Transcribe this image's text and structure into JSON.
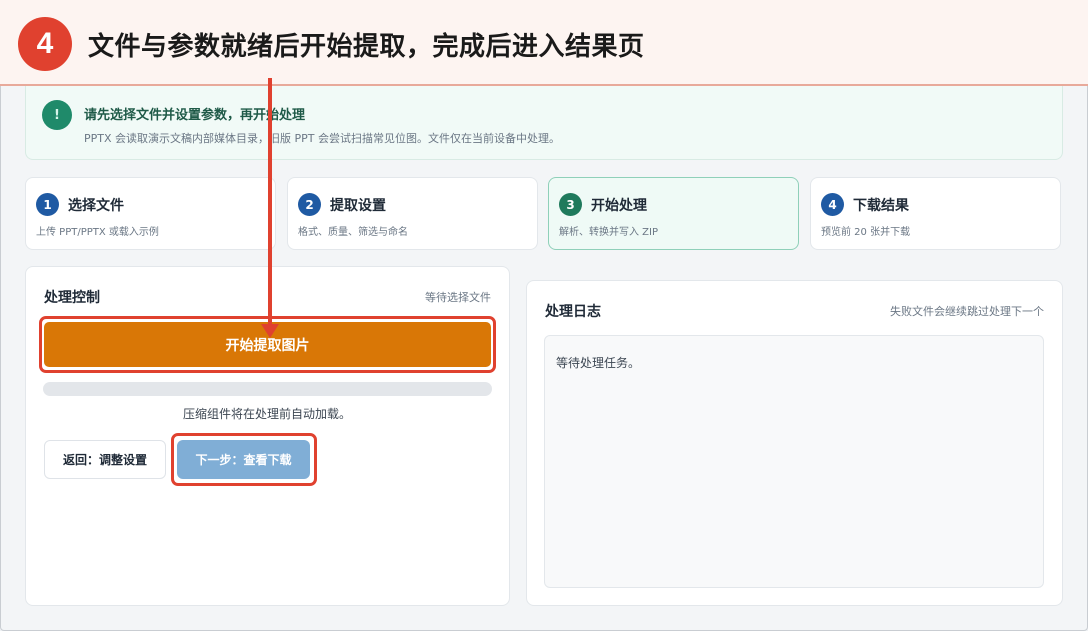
{
  "banner": {
    "step_number": "4",
    "title": "文件与参数就绪后开始提取，完成后进入结果页"
  },
  "notice": {
    "icon": "info-icon",
    "icon_glyph": "!",
    "title": "请先选择文件并设置参数，再开始处理",
    "subtitle": "PPTX 会读取演示文稿内部媒体目录，旧版 PPT 会尝试扫描常见位图。文件仅在当前设备中处理。"
  },
  "steps": [
    {
      "num": "1",
      "title": "选择文件",
      "desc": "上传 PPT/PPTX 或载入示例",
      "active": false
    },
    {
      "num": "2",
      "title": "提取设置",
      "desc": "格式、质量、筛选与命名",
      "active": false
    },
    {
      "num": "3",
      "title": "开始处理",
      "desc": "解析、转换并写入 ZIP",
      "active": true
    },
    {
      "num": "4",
      "title": "下载结果",
      "desc": "预览前 20 张并下载",
      "active": false
    }
  ],
  "control_panel": {
    "title": "处理控制",
    "status": "等待选择文件",
    "start_button": "开始提取图片",
    "progress": 0,
    "progress_hint": "压缩组件将在处理前自动加载。",
    "back_button": "返回：调整设置",
    "next_button": "下一步：查看下载"
  },
  "log_panel": {
    "title": "处理日志",
    "meta": "失败文件会继续跳过处理下一个",
    "log_text": "等待处理任务。"
  },
  "colors": {
    "accent_orange": "#d97706",
    "annotation_red": "#e0412f",
    "step_blue": "#1f5aa3",
    "step_green": "#1f7a5c"
  }
}
